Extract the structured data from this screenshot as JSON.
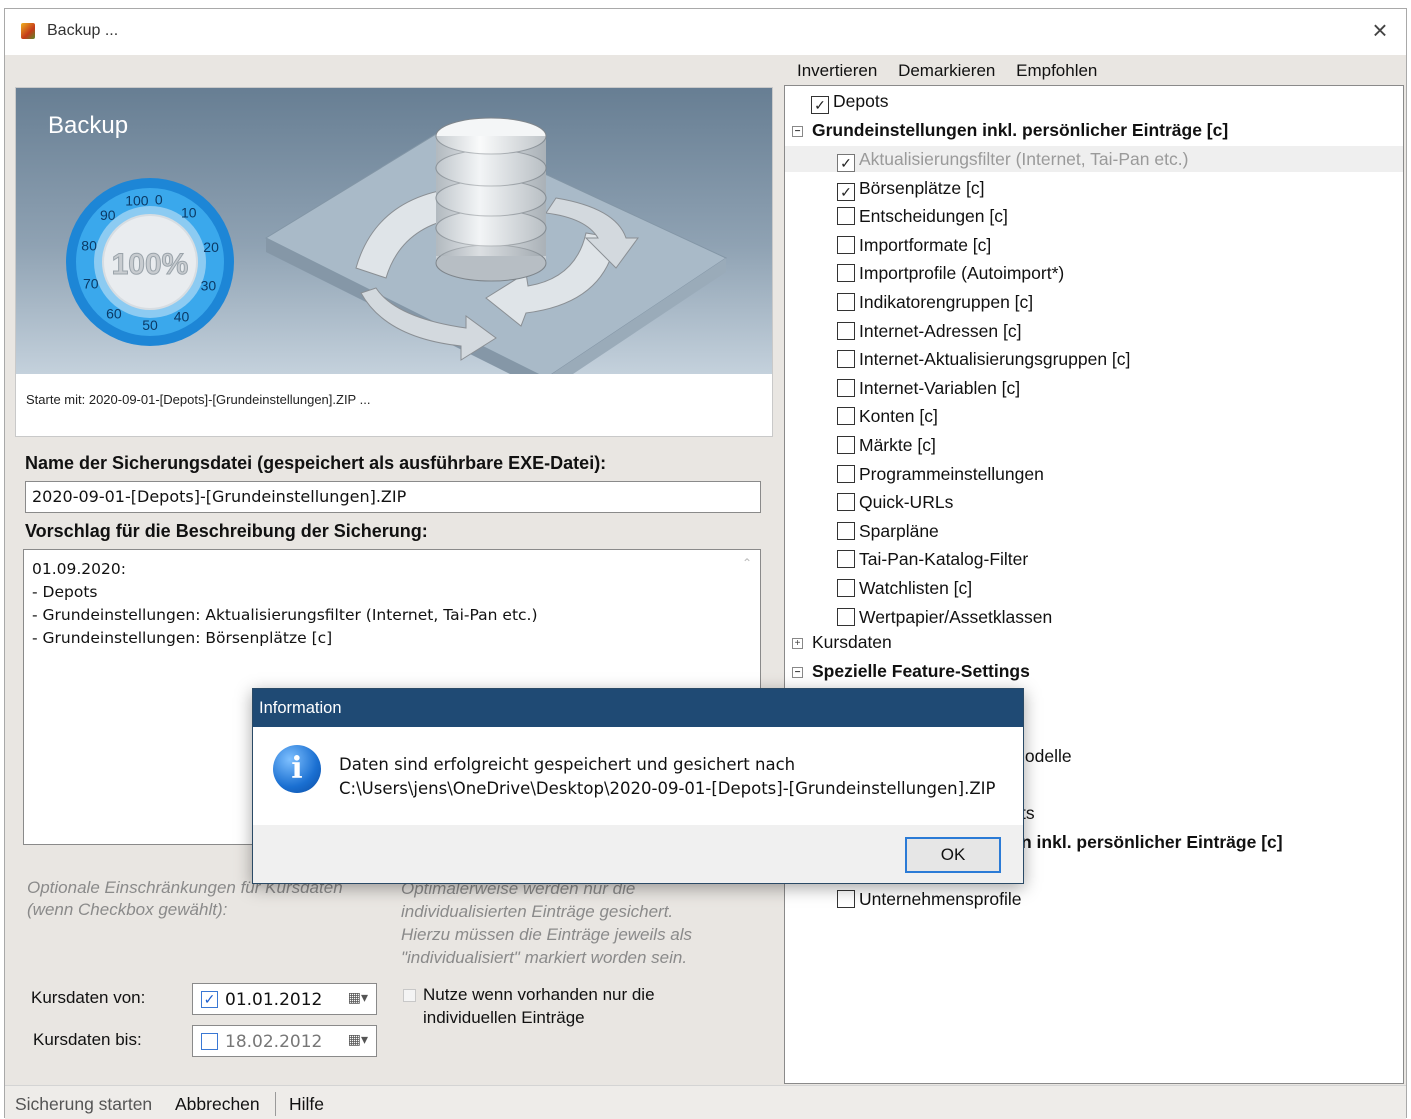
{
  "window": {
    "title": "Backup ..."
  },
  "banner": {
    "title": "Backup",
    "percent": "100%",
    "dial_ticks": [
      "100",
      "0",
      "10",
      "20",
      "30",
      "40",
      "50",
      "60",
      "70",
      "80",
      "90"
    ],
    "status": "Starte mit: 2020-09-01-[Depots]-[Grundeinstellungen].ZIP ..."
  },
  "form": {
    "filename_label": "Name der Sicherungsdatei (gespeichert als ausführbare EXE-Datei):",
    "filename_value": "2020-09-01-[Depots]-[Grundeinstellungen].ZIP",
    "description_label": "Vorschlag für die Beschreibung der Sicherung:",
    "description_lines": [
      "01.09.2020:",
      "- Depots",
      "- Grundeinstellungen: Aktualisierungsfilter (Internet, Tai-Pan etc.)",
      "- Grundeinstellungen: Börsenplätze [c]"
    ],
    "options_label_1": "Optionale Einschränkungen für Kursdaten",
    "options_label_2": "(wenn Checkbox gewählt):",
    "options_note": [
      "Optimalerweise werden nur die",
      "individualisierten Einträge gesichert.",
      "Hierzu müssen die Einträge jeweils als",
      "\"individualisiert\" markiert worden sein."
    ],
    "date_from_label": "Kursdaten von:",
    "date_from_value": "01.01.2012",
    "date_from_checked": true,
    "date_to_label": "Kursdaten bis:",
    "date_to_value": "18.02.2012",
    "date_to_checked": false,
    "individual_label_1": "Nutze wenn vorhanden nur die",
    "individual_label_2": "individuellen Einträge"
  },
  "right_menu": [
    "Invertieren",
    "Demarkieren",
    "Empfohlen"
  ],
  "tree": {
    "depots": "Depots",
    "grund_header": "Grundeinstellungen inkl. persönlicher Einträge [c]",
    "grund_items": [
      {
        "label": "Aktualisierungsfilter (Internet, Tai-Pan etc.)",
        "checked": true
      },
      {
        "label": "Börsenplätze [c]",
        "checked": true
      },
      {
        "label": "Entscheidungen [c]",
        "checked": false
      },
      {
        "label": "Importformate [c]",
        "checked": false
      },
      {
        "label": "Importprofile (Autoimport*)",
        "checked": false
      },
      {
        "label": "Indikatorengruppen [c]",
        "checked": false
      },
      {
        "label": "Internet-Adressen [c]",
        "checked": false
      },
      {
        "label": "Internet-Aktualisierungsgruppen [c]",
        "checked": false
      },
      {
        "label": "Internet-Variablen [c]",
        "checked": false
      },
      {
        "label": "Konten [c]",
        "checked": false
      },
      {
        "label": "Märkte [c]",
        "checked": false
      },
      {
        "label": "Programmeinstellungen",
        "checked": false
      },
      {
        "label": "Quick-URLs",
        "checked": false
      },
      {
        "label": "Sparpläne",
        "checked": false
      },
      {
        "label": "Tai-Pan-Katalog-Filter",
        "checked": false
      },
      {
        "label": "Watchlisten [c]",
        "checked": false
      },
      {
        "label": "Wertpapier/Assetklassen",
        "checked": false
      }
    ],
    "kursdaten": "Kursdaten",
    "spezielle": "Spezielle Feature-Settings",
    "partial_1": "lodelle",
    "partial_2": "ts",
    "partial_3": "n inkl. persönlicher Einträge [c]",
    "unternehmensprofile": "Unternehmensprofile"
  },
  "statusbar": {
    "start": "Sicherung starten",
    "cancel": "Abbrechen",
    "help": "Hilfe"
  },
  "dialog": {
    "title": "Information",
    "line1": "Daten sind erfolgreicht gespeichert und gesichert nach",
    "line2": "C:\\Users\\jens\\OneDrive\\Desktop\\2020-09-01-[Depots]-[Grundeinstellungen].ZIP",
    "ok": "OK"
  },
  "colors": {
    "dialog_title_bg": "#1f4a74",
    "dial_blue": "#2a96dd",
    "accent_focus": "#2b7bd6"
  }
}
